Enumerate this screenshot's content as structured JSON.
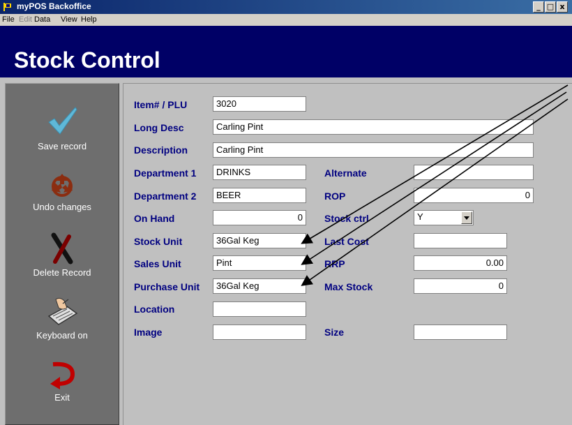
{
  "window": {
    "title": "myPOS Backoffice",
    "min": "_",
    "max": "□",
    "close": "x"
  },
  "menu": {
    "file": "File",
    "edit": "Edit",
    "data": "Data",
    "view": "View",
    "help": "Help"
  },
  "header": {
    "title": "Stock Control"
  },
  "sidebar": {
    "save": "Save record",
    "undo": "Undo changes",
    "del": "Delete Record",
    "kbd": "Keyboard on",
    "exit": "Exit"
  },
  "form": {
    "item_plu": {
      "label": "Item# / PLU",
      "value": "3020"
    },
    "long_desc": {
      "label": "Long Desc",
      "value": "Carling Pint"
    },
    "description": {
      "label": "Description",
      "value": "Carling Pint"
    },
    "dept1": {
      "label": "Department 1",
      "value": "DRINKS"
    },
    "dept2": {
      "label": "Department 2",
      "value": "BEER"
    },
    "on_hand": {
      "label": "On Hand",
      "value": "0"
    },
    "stock_unit": {
      "label": "Stock Unit",
      "value": "36Gal Keg"
    },
    "sales_unit": {
      "label": "Sales Unit",
      "value": "Pint"
    },
    "purchase_unit": {
      "label": "Purchase Unit",
      "value": "36Gal Keg"
    },
    "location": {
      "label": "Location",
      "value": ""
    },
    "image": {
      "label": "Image",
      "value": ""
    },
    "alternate": {
      "label": "Alternate",
      "value": ""
    },
    "rop": {
      "label": "ROP",
      "value": "0"
    },
    "stock_ctrl": {
      "label": "Stock ctrl",
      "value": "Y"
    },
    "last_cost": {
      "label": "Last Cost",
      "value": ""
    },
    "rrp": {
      "label": "RRP",
      "value": "0.00"
    },
    "max_stock": {
      "label": "Max Stock",
      "value": "0"
    },
    "size": {
      "label": "Size",
      "value": ""
    }
  }
}
